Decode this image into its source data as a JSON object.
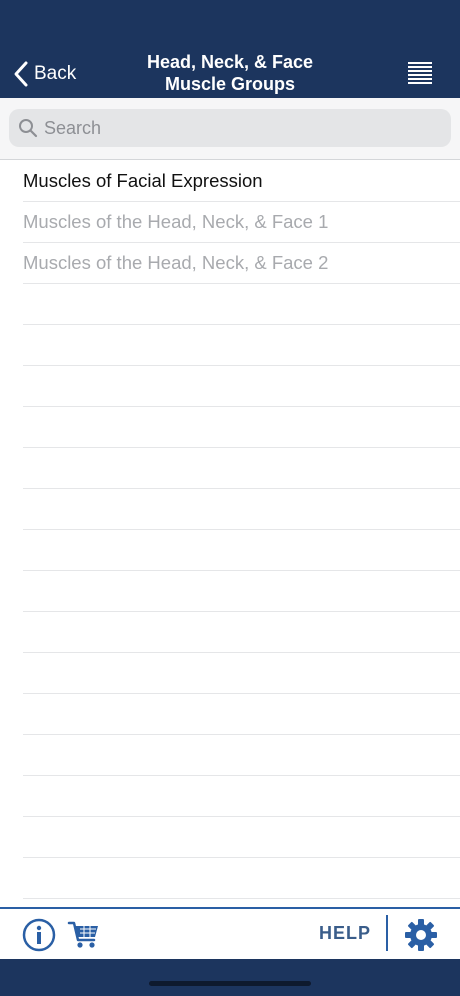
{
  "header": {
    "back_label": "Back",
    "title_line1": "Head, Neck, & Face",
    "title_line2": "Muscle Groups",
    "background": "#1c355e"
  },
  "search": {
    "placeholder": "Search",
    "value": ""
  },
  "list": {
    "items": [
      {
        "label": "Muscles of Facial Expression",
        "enabled": true
      },
      {
        "label": "Muscles of the Head, Neck, & Face 1",
        "enabled": false
      },
      {
        "label": "Muscles of the Head, Neck, & Face 2",
        "enabled": false
      }
    ],
    "empty_rows": 15
  },
  "footer": {
    "help_label": "HELP",
    "icons": [
      "info-icon",
      "cart-icon",
      "gear-icon"
    ],
    "accent": "#2a5fa5"
  }
}
